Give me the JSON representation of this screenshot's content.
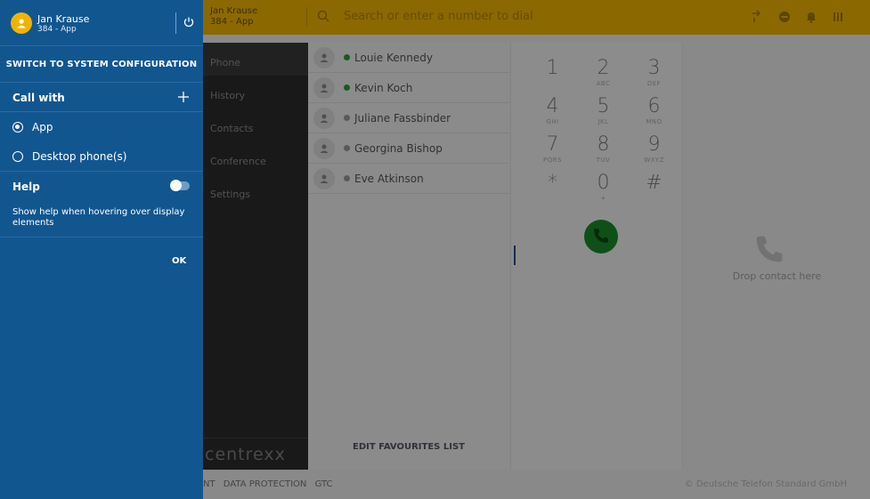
{
  "topbar": {
    "user_name": "Jan Krause",
    "user_sub": "384 - App",
    "search_placeholder": "Search or enter a number to dial"
  },
  "nav": {
    "items": [
      {
        "label": "Phone",
        "active": true
      },
      {
        "label": "History",
        "active": false
      },
      {
        "label": "Contacts",
        "active": false
      },
      {
        "label": "Conference",
        "active": false
      },
      {
        "label": "Settings",
        "active": false
      }
    ],
    "brand": "centrexx"
  },
  "favourites": {
    "contacts": [
      {
        "name": "Louie Kennedy",
        "status_color": "#2e9e3a"
      },
      {
        "name": "Kevin Koch",
        "status_color": "#2e9e3a"
      },
      {
        "name": "Juliane Fassbinder",
        "status_color": "#9a9a9a"
      },
      {
        "name": "Georgina Bishop",
        "status_color": "#9a9a9a"
      },
      {
        "name": "Eve Atkinson",
        "status_color": "#9a9a9a"
      }
    ],
    "edit_label": "EDIT FAVOURITES LIST"
  },
  "dialpad": {
    "keys": [
      {
        "digit": "1",
        "letters": ""
      },
      {
        "digit": "2",
        "letters": "ABC"
      },
      {
        "digit": "3",
        "letters": "DEF"
      },
      {
        "digit": "4",
        "letters": "GHI"
      },
      {
        "digit": "5",
        "letters": "JKL"
      },
      {
        "digit": "6",
        "letters": "MNO"
      },
      {
        "digit": "7",
        "letters": "PQRS"
      },
      {
        "digit": "8",
        "letters": "TUV"
      },
      {
        "digit": "9",
        "letters": "WXYZ"
      },
      {
        "digit": "*",
        "letters": ""
      },
      {
        "digit": "0",
        "letters": "+"
      },
      {
        "digit": "#",
        "letters": ""
      }
    ],
    "call_color": "#1a8a2a"
  },
  "dropzone": {
    "text": "Drop contact here"
  },
  "footer": {
    "links": [
      "NT",
      "DATA PROTECTION",
      "GTC"
    ],
    "copyright": "© Deutsche Telefon Standard GmbH"
  },
  "panel": {
    "user_name": "Jan Krause",
    "user_sub": "384 - App",
    "switch_label": "SWITCH TO SYSTEM CONFIGURATION",
    "call_with_label": "Call with",
    "options": [
      {
        "label": "App",
        "selected": true
      },
      {
        "label": "Desktop phone(s)",
        "selected": false
      }
    ],
    "help_label": "Help",
    "help_enabled": false,
    "help_description": "Show help when hovering over display elements",
    "ok_label": "OK",
    "accent": "#125690",
    "avatar_color": "#f0b400"
  }
}
